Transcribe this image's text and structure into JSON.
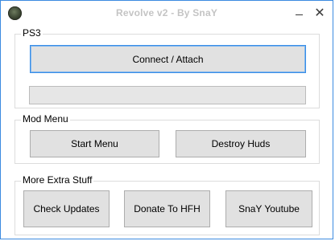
{
  "window": {
    "title": "Revolve v2 - By SnaY",
    "minimize_symbol": "",
    "close_symbol": "✕"
  },
  "ps3_group": {
    "label": "PS3",
    "connect_button": "Connect / Attach",
    "progress_value": 0
  },
  "mod_menu_group": {
    "label": "Mod Menu",
    "start_menu_button": "Start Menu",
    "destroy_huds_button": "Destroy Huds"
  },
  "extra_group": {
    "label": "More Extra Stuff",
    "check_updates_button": "Check Updates",
    "donate_button": "Donate To HFH",
    "youtube_button": "SnaY Youtube"
  },
  "colors": {
    "window_border": "#3c8be0",
    "title_text": "#c4c4c4",
    "button_face": "#e1e1e1",
    "focus_border": "#3a8ee6"
  }
}
